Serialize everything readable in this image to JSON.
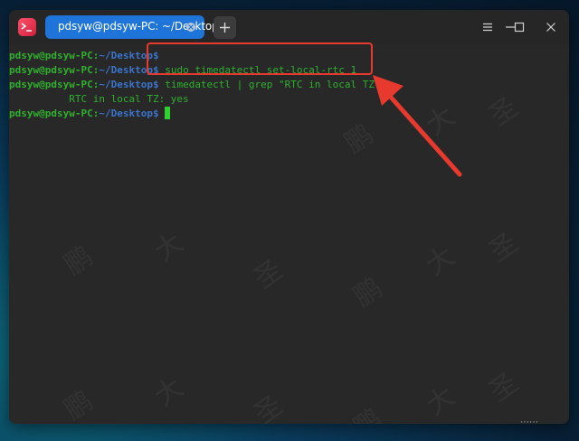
{
  "window": {
    "tab_title": "pdsyw@pdsyw-PC: ~/Desktop",
    "new_tab_symbol": "+",
    "buttons": [
      "menu-icon",
      "minimize-icon",
      "maximize-icon",
      "close-icon"
    ]
  },
  "terminal": {
    "lines": [
      {
        "user": "pdsyw@pdsyw-PC",
        "sep": ":",
        "path": "~/Desktop",
        "prompt": "$",
        "cmd": ""
      },
      {
        "user": "pdsyw@pdsyw-PC",
        "sep": ":",
        "path": "~/Desktop",
        "prompt": "$",
        "cmd": " sudo timedatectl set-local-rtc 1"
      },
      {
        "user": "pdsyw@pdsyw-PC",
        "sep": ":",
        "path": "~/Desktop",
        "prompt": "$",
        "cmd": " timedatectl | grep \"RTC in local TZ\""
      },
      {
        "output": "          RTC in local TZ: yes"
      },
      {
        "user": "pdsyw@pdsyw-PC",
        "sep": ":",
        "path": "~/Desktop",
        "prompt": "$",
        "cmd": " "
      }
    ]
  },
  "watermark": {
    "chars": [
      "鹏",
      "大",
      "圣"
    ]
  },
  "colors": {
    "accent": "#1e74d8",
    "annotation": "#e8392e",
    "prompt_green": "#2fb02f",
    "path_blue": "#3a74c8"
  }
}
